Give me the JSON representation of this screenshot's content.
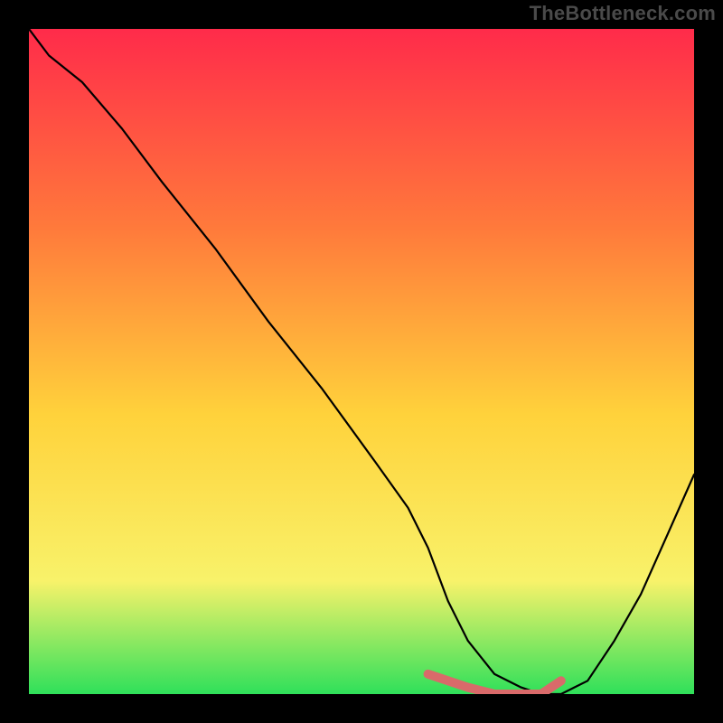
{
  "watermark": "TheBottleneck.com",
  "colors": {
    "frame": "#000000",
    "curve": "#000000",
    "marker": "#d96a6a",
    "gradient_top": "#ff2b4a",
    "gradient_mid1": "#ff7a3b",
    "gradient_mid2": "#ffd23b",
    "gradient_mid3": "#f8f26a",
    "gradient_bottom": "#2fe05a"
  },
  "chart_data": {
    "type": "line",
    "title": "",
    "xlabel": "",
    "ylabel": "",
    "xlim": [
      0,
      100
    ],
    "ylim": [
      0,
      100
    ],
    "x": [
      0,
      3,
      8,
      14,
      20,
      28,
      36,
      44,
      52,
      57,
      60,
      63,
      66,
      70,
      74,
      77,
      80,
      84,
      88,
      92,
      96,
      100
    ],
    "values": [
      100,
      96,
      92,
      85,
      77,
      67,
      56,
      46,
      35,
      28,
      22,
      14,
      8,
      3,
      1,
      0,
      0,
      2,
      8,
      15,
      24,
      33
    ],
    "marker_segment": {
      "x": [
        60,
        63,
        66,
        70,
        74,
        77,
        80
      ],
      "values": [
        3,
        2,
        1,
        0,
        0,
        0,
        2
      ]
    }
  }
}
